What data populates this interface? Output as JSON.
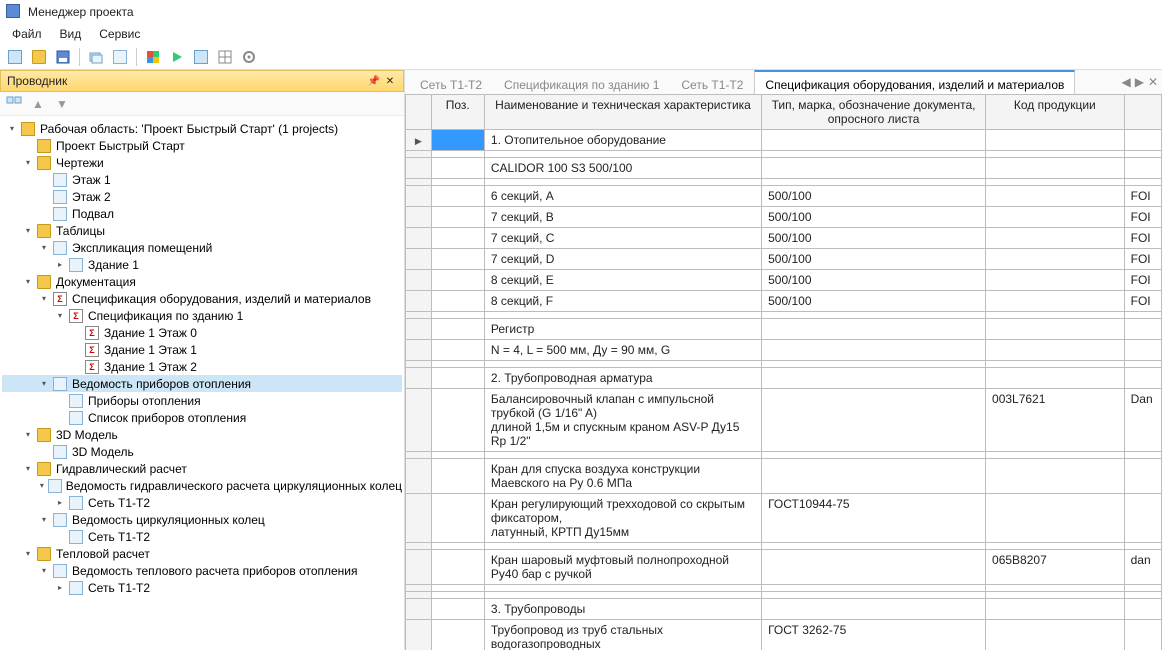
{
  "app_title": "Менеджер проекта",
  "menus": [
    "Файл",
    "Вид",
    "Сервис"
  ],
  "explorer": {
    "panel_title": "Проводник",
    "root": "Рабочая область: 'Проект Быстрый Старт' (1 projects)",
    "project": "Проект Быстрый Старт",
    "drawings": "Чертежи",
    "drawings_children": [
      "Этаж 1",
      "Этаж 2",
      "Подвал"
    ],
    "tables": "Таблицы",
    "room_expl": "Экспликация помещений",
    "building1": "Здание 1",
    "documentation": "Документация",
    "spec_equip": "Спецификация оборудования, изделий и материалов",
    "spec_by_building": "Спецификация по зданию 1",
    "spec_children": [
      "Здание 1 Этаж 0",
      "Здание 1 Этаж 1",
      "Здание 1 Этаж 2"
    ],
    "heating_list": "Ведомость приборов отопления",
    "heating_children": [
      "Приборы отопления",
      "Список приборов отопления"
    ],
    "model3d": "3D Модель",
    "model3d_child": "3D Модель",
    "hydraulic": "Гидравлический расчет",
    "hydraulic_list": "Ведомость гидравлического расчета циркуляционных колец",
    "network_t1t2": "Сеть T1-T2",
    "circ_rings_list": "Ведомость циркуляционных колец",
    "thermal": "Тепловой расчет",
    "thermal_list": "Ведомость теплового расчета приборов отопления"
  },
  "tabs": [
    "Сеть T1-T2",
    "Спецификация по зданию 1",
    "Сеть T1-T2",
    "Спецификация оборудования, изделий и материалов"
  ],
  "active_tab": 3,
  "grid": {
    "headers": {
      "pos": "Поз.",
      "name": "Наименование и техническая характеристика",
      "type": "Тип, марка, обозначение документа, опросного листа",
      "code": "Код продукции"
    },
    "rows": [
      {
        "marker": "▶",
        "pos_selected": true,
        "name": "1. Отопительное оборудование",
        "type": "",
        "code": ""
      },
      {
        "name": "",
        "type": "",
        "code": ""
      },
      {
        "name": "CALIDOR 100 S3 500/100",
        "type": "",
        "code": ""
      },
      {
        "name": "",
        "type": "",
        "code": ""
      },
      {
        "name": "6 секций, A",
        "type": "500/100",
        "code": "",
        "trail": "FOI"
      },
      {
        "name": "7 секций, B",
        "type": "500/100",
        "code": "",
        "trail": "FOI"
      },
      {
        "name": "7 секций, C",
        "type": "500/100",
        "code": "",
        "trail": "FOI"
      },
      {
        "name": "7 секций, D",
        "type": "500/100",
        "code": "",
        "trail": "FOI"
      },
      {
        "name": "8 секций, E",
        "type": "500/100",
        "code": "",
        "trail": "FOI"
      },
      {
        "name": "8 секций, F",
        "type": "500/100",
        "code": "",
        "trail": "FOI"
      },
      {
        "name": "",
        "type": "",
        "code": ""
      },
      {
        "name": "Регистр",
        "type": "",
        "code": ""
      },
      {
        "name": "N = 4, L = 500 мм, Ду = 90 мм, G",
        "type": "",
        "code": ""
      },
      {
        "name": "",
        "type": "",
        "code": ""
      },
      {
        "name": "2. Трубопроводная арматура",
        "type": "",
        "code": ""
      },
      {
        "name": "Балансировочный клапан с импульсной трубкой (G 1/16\" A)\nдлиной 1,5м и спускным краном ASV-P Ду15 Rp 1/2\"",
        "type": "",
        "code": "003L7621",
        "trail": "Dan"
      },
      {
        "name": "",
        "type": "",
        "code": ""
      },
      {
        "name": "Кран для спуска воздуха конструкции Маевского на Ру 0.6 МПа",
        "type": "",
        "code": ""
      },
      {
        "name": "Кран регулирующий трехходовой со скрытым фиксатором,\nлатунный, КРТП Ду15мм",
        "type": "ГОСТ10944-75",
        "code": ""
      },
      {
        "name": "",
        "type": "",
        "code": ""
      },
      {
        "name": "Кран шаровый муфтовый полнопроходной Ру40 бар с ручкой",
        "type": "",
        "code": "065B8207",
        "trail": "dan"
      },
      {
        "name": "",
        "type": "",
        "code": ""
      },
      {
        "name": "",
        "type": "",
        "code": ""
      },
      {
        "name": "3. Трубопроводы",
        "type": "",
        "code": ""
      },
      {
        "name": "Трубопровод из труб стальных водогазопроводных",
        "type": "ГОСТ 3262-75",
        "code": ""
      }
    ]
  }
}
